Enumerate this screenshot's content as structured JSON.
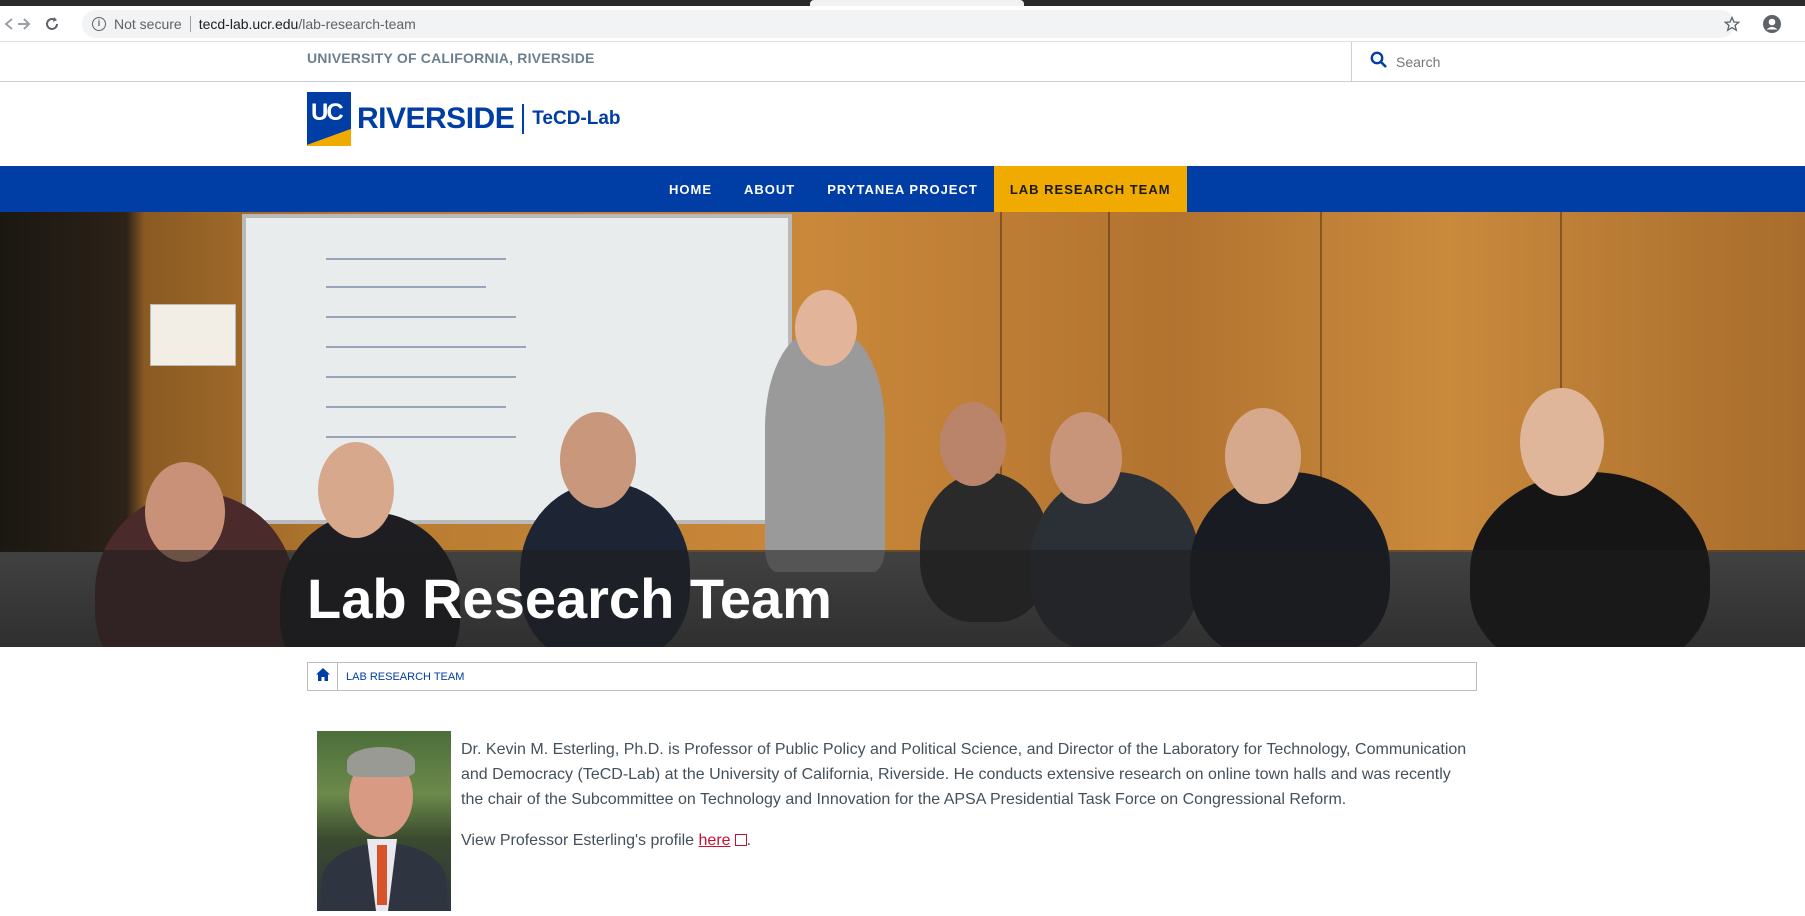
{
  "browser": {
    "security_label": "Not secure",
    "url_host": "tecd-lab.ucr.edu",
    "url_path": "/lab-research-team"
  },
  "top_strip": {
    "university_name": "UNIVERSITY OF CALIFORNIA, RIVERSIDE",
    "search_placeholder": "Search"
  },
  "logo": {
    "uc_mark": "UC",
    "wordmark": "RIVERSIDE",
    "site_name": "TeCD-Lab"
  },
  "nav": {
    "items": [
      {
        "label": "HOME"
      },
      {
        "label": "ABOUT"
      },
      {
        "label": "PRYTANEA PROJECT"
      },
      {
        "label": "LAB RESEARCH TEAM",
        "active": true
      }
    ]
  },
  "hero": {
    "title": "Lab Research Team"
  },
  "breadcrumb": {
    "current": "LAB RESEARCH TEAM"
  },
  "content": {
    "bio_text": "Dr. Kevin M. Esterling, Ph.D. is Professor of Public Policy and Political Science, and Director of the Laboratory for Technology, Communication and Democracy (TeCD-Lab) at the University of California, Riverside. He conducts extensive research on online town halls and was recently the chair of the Subcommittee on Technology and Innovation for the APSA Presidential Task Force on Congressional Reform.",
    "profile_prefix": "View Professor Esterling's profile ",
    "profile_link": "here",
    "profile_suffix": "."
  },
  "colors": {
    "ucr_blue": "#003da5",
    "ucr_gold": "#f1ab00",
    "link_red": "#c8102e"
  }
}
